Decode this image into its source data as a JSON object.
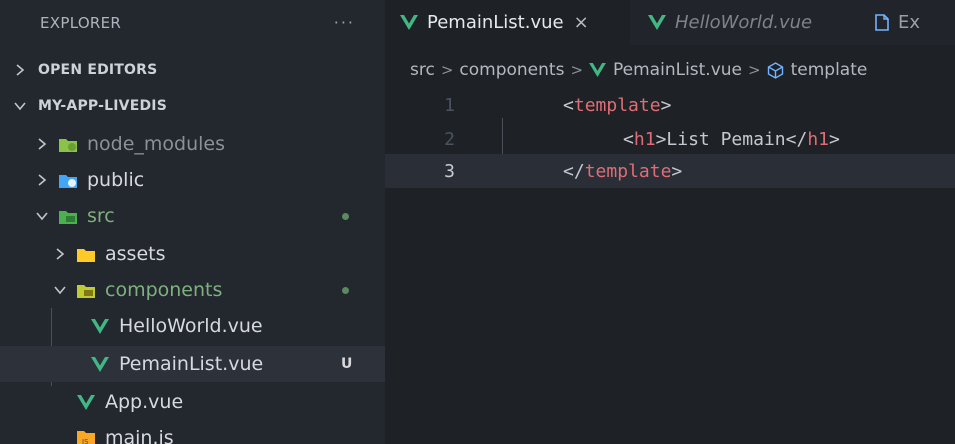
{
  "sidebar": {
    "header_title": "EXPLORER",
    "more_label": "···",
    "sections": {
      "open_editors": "OPEN EDITORS",
      "project": "MY-APP-LIVEDIS"
    },
    "tree": [
      {
        "label": "node_modules",
        "kind": "folder",
        "icon": "node-modules-folder-icon",
        "color": "#8a9199"
      },
      {
        "label": "public",
        "kind": "folder",
        "icon": "public-folder-icon",
        "color": "#d6dae0"
      },
      {
        "label": "src",
        "kind": "folder",
        "icon": "src-folder-icon",
        "color": "#7fb07f"
      },
      {
        "label": "assets",
        "kind": "folder",
        "icon": "assets-folder-icon",
        "color": "#d6dae0"
      },
      {
        "label": "components",
        "kind": "folder",
        "icon": "components-folder-icon",
        "color": "#7fb07f"
      },
      {
        "label": "HelloWorld.vue",
        "kind": "file",
        "icon": "vue-icon",
        "color": "#d6dae0"
      },
      {
        "label": "PemainList.vue",
        "kind": "file",
        "icon": "vue-icon",
        "color": "#d6dae0",
        "badge": "U"
      },
      {
        "label": "App.vue",
        "kind": "file",
        "icon": "vue-icon",
        "color": "#d6dae0"
      },
      {
        "label": "main.js",
        "kind": "file",
        "icon": "js-icon",
        "color": "#d6dae0"
      }
    ]
  },
  "tabs": [
    {
      "label": "PemainList.vue",
      "close": "×",
      "active": true
    },
    {
      "label": "HelloWorld.vue",
      "active": false
    },
    {
      "label": "Ex",
      "active": false
    }
  ],
  "breadcrumb": {
    "segments": [
      "src",
      "components",
      "PemainList.vue",
      "template"
    ],
    "separator": ">"
  },
  "editor": {
    "lines": [
      {
        "number": "1",
        "parts": [
          {
            "t": "<",
            "c": "bracket"
          },
          {
            "t": "template",
            "c": "tag"
          },
          {
            "t": ">",
            "c": "bracket"
          }
        ]
      },
      {
        "number": "2",
        "parts": [
          {
            "t": "<",
            "c": "bracket"
          },
          {
            "t": "h1",
            "c": "tag"
          },
          {
            "t": ">",
            "c": "bracket"
          },
          {
            "t": "List Pemain",
            "c": "text"
          },
          {
            "t": "</",
            "c": "bracket"
          },
          {
            "t": "h1",
            "c": "tag"
          },
          {
            "t": ">",
            "c": "bracket"
          }
        ]
      },
      {
        "number": "3",
        "parts": [
          {
            "t": "</",
            "c": "bracket"
          },
          {
            "t": "template",
            "c": "tag"
          },
          {
            "t": ">",
            "c": "bracket"
          }
        ]
      }
    ],
    "current_line": 3
  },
  "colors": {
    "vue_green": "#41b883",
    "tag_red": "#e06c75",
    "git_dot": "#5a8a5f",
    "background": "#1e2227"
  }
}
